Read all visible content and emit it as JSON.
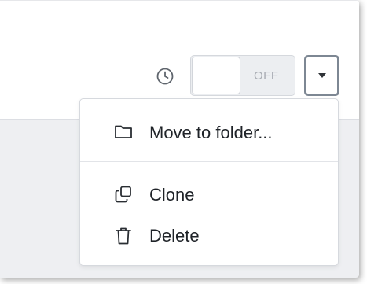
{
  "toolbar": {
    "schedule_icon": "clock-icon",
    "toggle": {
      "state_label": "OFF"
    },
    "dropdown_icon": "caret-down-icon"
  },
  "menu": {
    "items": [
      {
        "label": "Move to folder...",
        "icon": "folder-icon"
      },
      {
        "label": "Clone",
        "icon": "clone-icon"
      },
      {
        "label": "Delete",
        "icon": "trash-icon"
      }
    ]
  },
  "colors": {
    "focus_border": "#7d8793",
    "toggle_off_text": "#a8acb3",
    "background": "#eeeff2",
    "text": "#1f2328"
  }
}
